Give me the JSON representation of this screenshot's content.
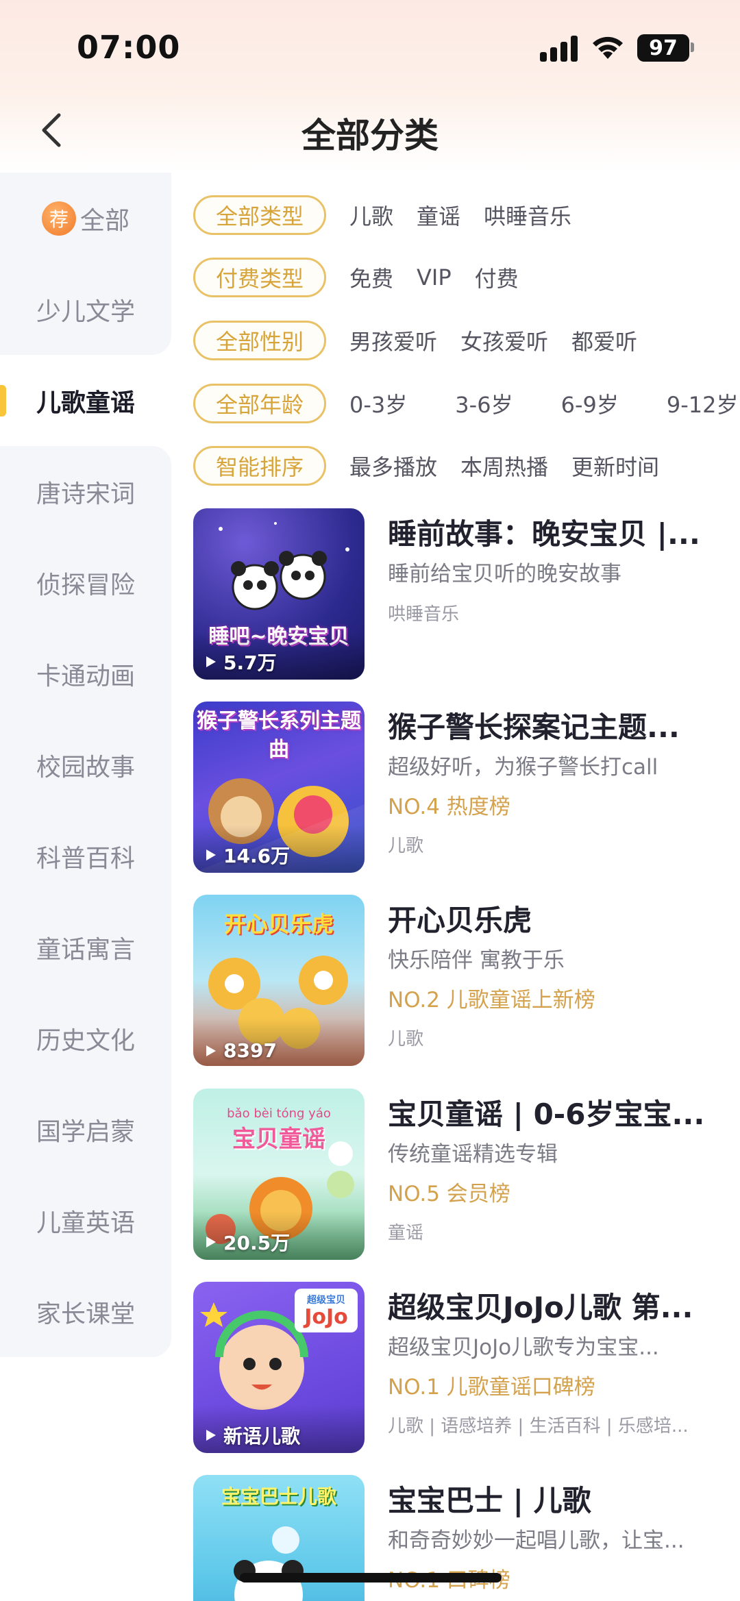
{
  "status_bar": {
    "time": "07:00",
    "battery": "97"
  },
  "header": {
    "title": "全部分类"
  },
  "sidebar": {
    "items": [
      {
        "label": "全部",
        "badge": "荐"
      },
      {
        "label": "少儿文学"
      },
      {
        "label": "儿歌童谣"
      },
      {
        "label": "唐诗宋词"
      },
      {
        "label": "侦探冒险"
      },
      {
        "label": "卡通动画"
      },
      {
        "label": "校园故事"
      },
      {
        "label": "科普百科"
      },
      {
        "label": "童话寓言"
      },
      {
        "label": "历史文化"
      },
      {
        "label": "国学启蒙"
      },
      {
        "label": "儿童英语"
      },
      {
        "label": "家长课堂"
      }
    ],
    "selected": "儿歌童谣"
  },
  "filters": [
    {
      "selected": "全部类型",
      "options": [
        "儿歌",
        "童谣",
        "哄睡音乐"
      ]
    },
    {
      "selected": "付费类型",
      "options": [
        "免费",
        "VIP",
        "付费"
      ]
    },
    {
      "selected": "全部性别",
      "options": [
        "男孩爱听",
        "女孩爱听",
        "都爱听"
      ]
    },
    {
      "selected": "全部年龄",
      "options": [
        "0-3岁",
        "3-6岁",
        "6-9岁",
        "9-12岁"
      ]
    },
    {
      "selected": "智能排序",
      "options": [
        "最多播放",
        "本周热播",
        "更新时间"
      ]
    }
  ],
  "albums": [
    {
      "title": "睡前故事：晚安宝贝 |...",
      "desc": "睡前给宝贝听的晚安故事",
      "rank": "",
      "tags": "哄睡音乐",
      "plays": "5.7万",
      "cover_text": "睡吧~晚安宝贝"
    },
    {
      "title": "猴子警长探案记主题...",
      "desc": "超级好听，为猴子警长打call",
      "rank": "NO.4 热度榜",
      "tags": "儿歌",
      "plays": "14.6万",
      "cover_text": "猴子警长系列主题曲"
    },
    {
      "title": "开心贝乐虎",
      "desc": "快乐陪伴 寓教于乐",
      "rank": "NO.2 儿歌童谣上新榜",
      "tags": "儿歌",
      "plays": "8397",
      "cover_text": "开心贝乐虎"
    },
    {
      "title": "宝贝童谣 | 0-6岁宝宝...",
      "desc": "传统童谣精选专辑",
      "rank": "NO.5 会员榜",
      "tags": "童谣",
      "plays": "20.5万",
      "cover_text": "宝贝童谣",
      "cover_pinyin": "bǎo bèi tóng yáo"
    },
    {
      "title": "超级宝贝JoJo儿歌 第...",
      "desc": "超级宝贝JoJo儿歌专为宝宝...",
      "rank": "NO.1 儿歌童谣口碑榜",
      "tags": "儿歌 | 语感培养 | 生活百科 | 乐感培...",
      "plays": "",
      "cover_text": "JoJo",
      "cover_subtext": "超级宝贝",
      "cover_bottom": "新语儿歌"
    },
    {
      "title": "宝宝巴士 | 儿歌",
      "desc": "和奇奇妙妙一起唱儿歌，让宝...",
      "rank": "NO.1 口碑榜",
      "tags": "",
      "plays": "",
      "cover_text": "宝宝巴士儿歌"
    }
  ]
}
